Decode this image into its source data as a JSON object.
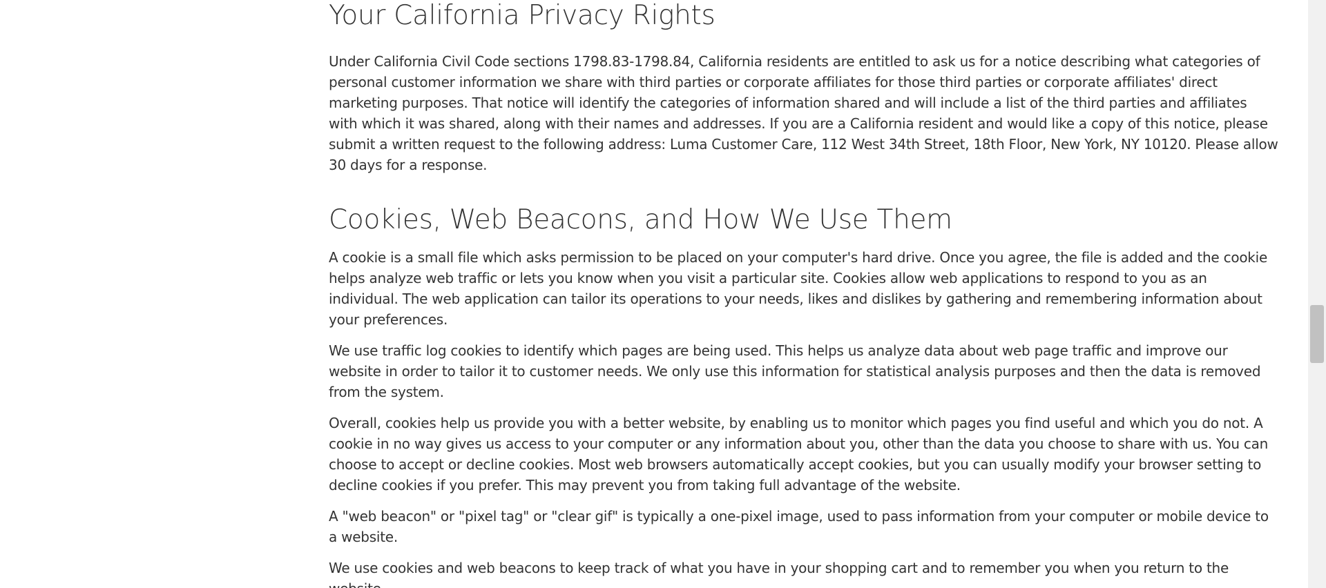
{
  "sections": [
    {
      "heading": "Your California Privacy Rights",
      "paragraphs": [
        "Under California Civil Code sections 1798.83-1798.84, California residents are entitled to ask us for a notice describing what categories of personal customer information we share with third parties or corporate affiliates for those third parties or corporate affiliates' direct marketing purposes. That notice will identify the categories of information shared and will include a list of the third parties and affiliates with which it was shared, along with their names and addresses. If you are a California resident and would like a copy of this notice, please submit a written request to the following address: Luma Customer Care, 112 West 34th Street, 18th Floor, New York, NY 10120. Please allow 30 days for a response."
      ]
    },
    {
      "heading": "Cookies, Web Beacons, and How We Use Them",
      "paragraphs": [
        "A cookie is a small file which asks permission to be placed on your computer's hard drive. Once you agree, the file is added and the cookie helps analyze web traffic or lets you know when you visit a particular site. Cookies allow web applications to respond to you as an individual. The web application can tailor its operations to your needs, likes and dislikes by gathering and remembering information about your preferences.",
        "We use traffic log cookies to identify which pages are being used. This helps us analyze data about web page traffic and improve our website in order to tailor it to customer needs. We only use this information for statistical analysis purposes and then the data is removed from the system.",
        "Overall, cookies help us provide you with a better website, by enabling us to monitor which pages you find useful and which you do not. A cookie in no way gives us access to your computer or any information about you, other than the data you choose to share with us. You can choose to accept or decline cookies. Most web browsers automatically accept cookies, but you can usually modify your browser setting to decline cookies if you prefer. This may prevent you from taking full advantage of the website.",
        "A \"web beacon\" or \"pixel tag\" or \"clear gif\" is typically a one-pixel image, used to pass information from your computer or mobile device to a website.",
        "We use cookies and web beacons to keep track of what you have in your shopping cart and to remember you when you return to the website"
      ]
    }
  ],
  "colors": {
    "text": "#333333",
    "background": "#ffffff",
    "scrollbar_track": "#f1f1f1",
    "scrollbar_thumb": "#c1c1c1"
  }
}
